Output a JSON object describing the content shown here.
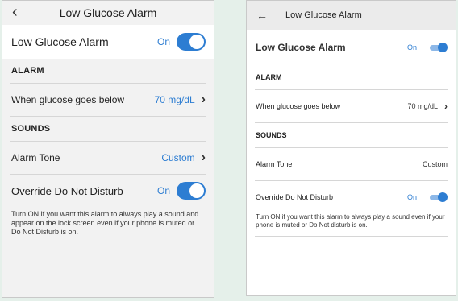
{
  "ios": {
    "header": {
      "back_icon": "chevron-left-icon",
      "title": "Low Glucose Alarm"
    },
    "main_toggle": {
      "label": "Low Glucose Alarm",
      "state": "On"
    },
    "alarm_section": {
      "title": "ALARM"
    },
    "glucose_threshold": {
      "label": "When glucose goes below",
      "value": "70 mg/dL"
    },
    "sounds_section": {
      "title": "SOUNDS"
    },
    "alarm_tone": {
      "label": "Alarm Tone",
      "value": "Custom"
    },
    "dnd_override": {
      "label": "Override Do Not Disturb",
      "state": "On"
    },
    "note": "Turn ON if you want this alarm to always play a sound and appear on the lock screen even if your phone is muted or Do Not Disturb is on."
  },
  "android": {
    "header": {
      "back_icon": "arrow-left-icon",
      "title": "Low Glucose Alarm"
    },
    "main_toggle": {
      "label": "Low Glucose Alarm",
      "state": "On"
    },
    "alarm_section": {
      "title": "ALARM"
    },
    "glucose_threshold": {
      "label": "When glucose goes below",
      "value": "70 mg/dL"
    },
    "sounds_section": {
      "title": "SOUNDS"
    },
    "alarm_tone": {
      "label": "Alarm Tone",
      "value": "Custom"
    },
    "dnd_override": {
      "label": "Override Do Not Disturb",
      "state": "On"
    },
    "note": "Turn ON if you want this alarm to always play a sound even if your phone is muted or Do Not disturb is on."
  },
  "colors": {
    "accent": "#2d7dd2",
    "background": "#e5f0ea"
  }
}
